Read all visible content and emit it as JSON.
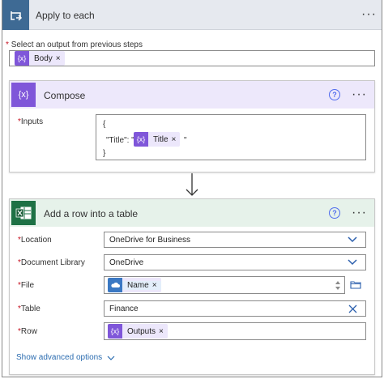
{
  "apply_each": {
    "title": "Apply to each",
    "select_label": "Select an output from previous steps",
    "token_label": "Body",
    "token_remove": "×"
  },
  "compose": {
    "title": "Compose",
    "inputs_label": "Inputs",
    "line1": "{",
    "line2_prefix": "\"Title\": \"",
    "token_label": "Title",
    "token_remove": "×",
    "line2_suffix": "\"",
    "line3": "}"
  },
  "excel": {
    "title": "Add a row into a table",
    "location_label": "Location",
    "location_value": "OneDrive for Business",
    "library_label": "Document Library",
    "library_value": "OneDrive",
    "file_label": "File",
    "file_token": "Name",
    "table_label": "Table",
    "table_value": "Finance",
    "row_label": "Row",
    "row_token": "Outputs",
    "token_remove": "×",
    "advanced_label": "Show advanced options"
  },
  "common": {
    "required_mark": "*",
    "more_dots": "···",
    "help_glyph": "?",
    "expr_glyph": "{x}"
  },
  "colors": {
    "loop_header": "#3e6a94",
    "compose_accent": "#7f56d9",
    "excel_accent": "#1e7145",
    "link": "#2b6cb0"
  },
  "icons": [
    "loop-icon",
    "compose-icon",
    "excel-icon",
    "help-icon",
    "chevron-down-icon",
    "clear-icon",
    "folder-icon",
    "onedrive-icon",
    "arrow-down-icon"
  ]
}
